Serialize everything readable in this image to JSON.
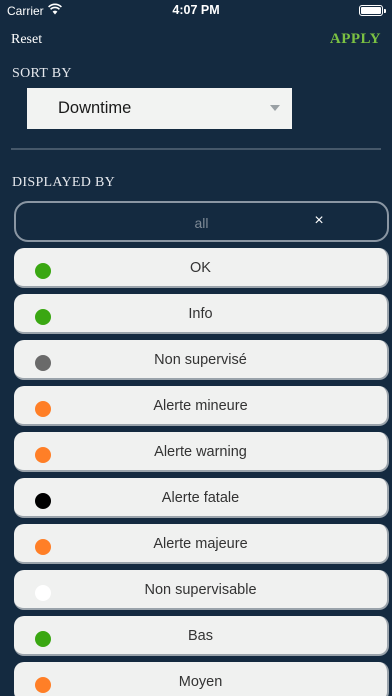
{
  "status_bar": {
    "carrier": "Carrier",
    "time": "4:07 PM",
    "wifi_icon": "wifi-icon",
    "battery_icon": "battery-icon"
  },
  "nav": {
    "reset_label": "Reset",
    "apply_label": "APPLY",
    "apply_color": "#7bc142"
  },
  "sort": {
    "section_label": "SORT BY",
    "selected_value": "Downtime",
    "caret_icon": "caret-down-icon"
  },
  "display": {
    "section_label": "DISPLAYED BY",
    "filter_value": "all",
    "clear_symbol": "×"
  },
  "statuses": [
    {
      "label": "OK",
      "color": "#3aa712"
    },
    {
      "label": "Info",
      "color": "#3aa712"
    },
    {
      "label": "Non supervisé",
      "color": "#6a6a6a"
    },
    {
      "label": "Alerte mineure",
      "color": "#ff7f27"
    },
    {
      "label": "Alerte warning",
      "color": "#ff7f27"
    },
    {
      "label": "Alerte fatale",
      "color": "#000000"
    },
    {
      "label": "Alerte majeure",
      "color": "#ff7f27"
    },
    {
      "label": "Non supervisable",
      "color": "#ffffff"
    },
    {
      "label": "Bas",
      "color": "#3aa712"
    },
    {
      "label": "Moyen",
      "color": "#ff7f27"
    }
  ]
}
